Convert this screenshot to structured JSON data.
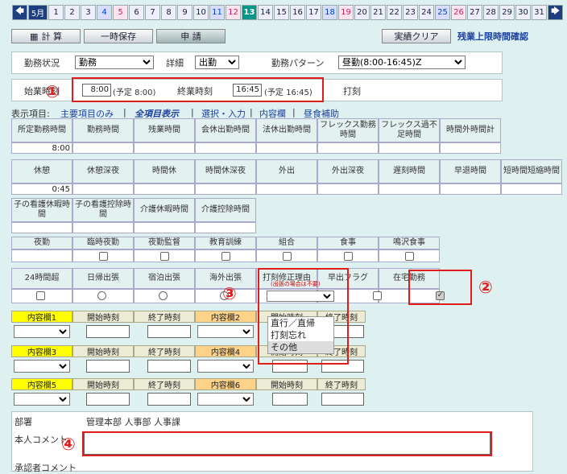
{
  "date_bar": {
    "prev": "🡄",
    "month": "5月",
    "days": [
      "1",
      "2",
      "3",
      "4",
      "5",
      "6",
      "7",
      "8",
      "9",
      "10",
      "11",
      "12",
      "13",
      "14",
      "15",
      "16",
      "17",
      "18",
      "19",
      "20",
      "21",
      "22",
      "23",
      "24",
      "25",
      "26",
      "27",
      "28",
      "29",
      "30",
      "31"
    ],
    "next": "🡆",
    "current": "13"
  },
  "toolbar": {
    "calc": "計 算",
    "temp_save": "一時保存",
    "apply": "申 請",
    "actual_clear": "実績クリア",
    "overtime_link": "残業上限時間確認"
  },
  "form": {
    "status_label": "勤務状況",
    "status_value": "勤務",
    "detail_label": "詳細",
    "detail_value": "出勤",
    "pattern_label": "勤務パターン",
    "pattern_value": "昼勤(8:00-16:45)Z",
    "start_label": "始業時刻",
    "start_value": "8:00",
    "start_planned": "(予定 8:00)",
    "end_label": "終業時刻",
    "end_value": "16:45",
    "end_planned": "(予定 16:45)",
    "stamp_label": "打刻"
  },
  "display": {
    "label": "表示項目:",
    "main": "主要項目のみ",
    "all": "全項目表示",
    "select_input": "選択・入力",
    "content": "内容欄",
    "lunch": "昼食補助"
  },
  "row1": {
    "headers": [
      "所定勤務時間",
      "勤務時間",
      "残業時間",
      "会休出勤時間",
      "法休出勤時間",
      "フレックス勤務時間",
      "フレックス過不足時間",
      "時間外時間計"
    ],
    "values": [
      "8:00",
      "",
      "",
      "",
      "",
      "",
      "",
      ""
    ]
  },
  "row2": {
    "headers": [
      "休憩",
      "休憩深夜",
      "時間休",
      "時間休深夜",
      "外出",
      "外出深夜",
      "遅刻時間",
      "早退時間",
      "短時間短縮時間"
    ],
    "values": [
      "0:45"
    ]
  },
  "row3": {
    "headers": [
      "子の看護休暇時間",
      "子の看護控除時間",
      "介護休暇時間",
      "介護控除時間"
    ]
  },
  "row4": {
    "headers": [
      "夜勤",
      "臨時夜勤",
      "夜勤監督",
      "教育訓練",
      "組合",
      "食事",
      "鳴沢食事"
    ]
  },
  "row5": {
    "headers": [
      "24時間超",
      "日帰出張",
      "宿泊出張",
      "海外出張",
      "打刻修正理由",
      "早出フラグ",
      "在宅勤務"
    ],
    "reason_note": "(出張の場合は不要)",
    "reason_options": [
      "直行／直帰",
      "打刻忘れ",
      "その他"
    ],
    "wfh_checked": true
  },
  "content": {
    "c1": "内容欄1",
    "c2": "内容欄2",
    "c3": "内容欄3",
    "c4": "内容欄4",
    "c5": "内容欄5",
    "c6": "内容欄6",
    "start": "開始時刻",
    "end": "終了時刻"
  },
  "bottom": {
    "dept_label": "部署",
    "dept_value": "管理本部 人事部 人事課",
    "comment_label": "本人コメント",
    "approver_label": "承認者コメント"
  },
  "annotations": [
    "①",
    "②",
    "③",
    "④"
  ],
  "colors": {
    "accent_red": "#e21b1b",
    "current_day": "#009688",
    "nav": "#1e3f7f"
  }
}
